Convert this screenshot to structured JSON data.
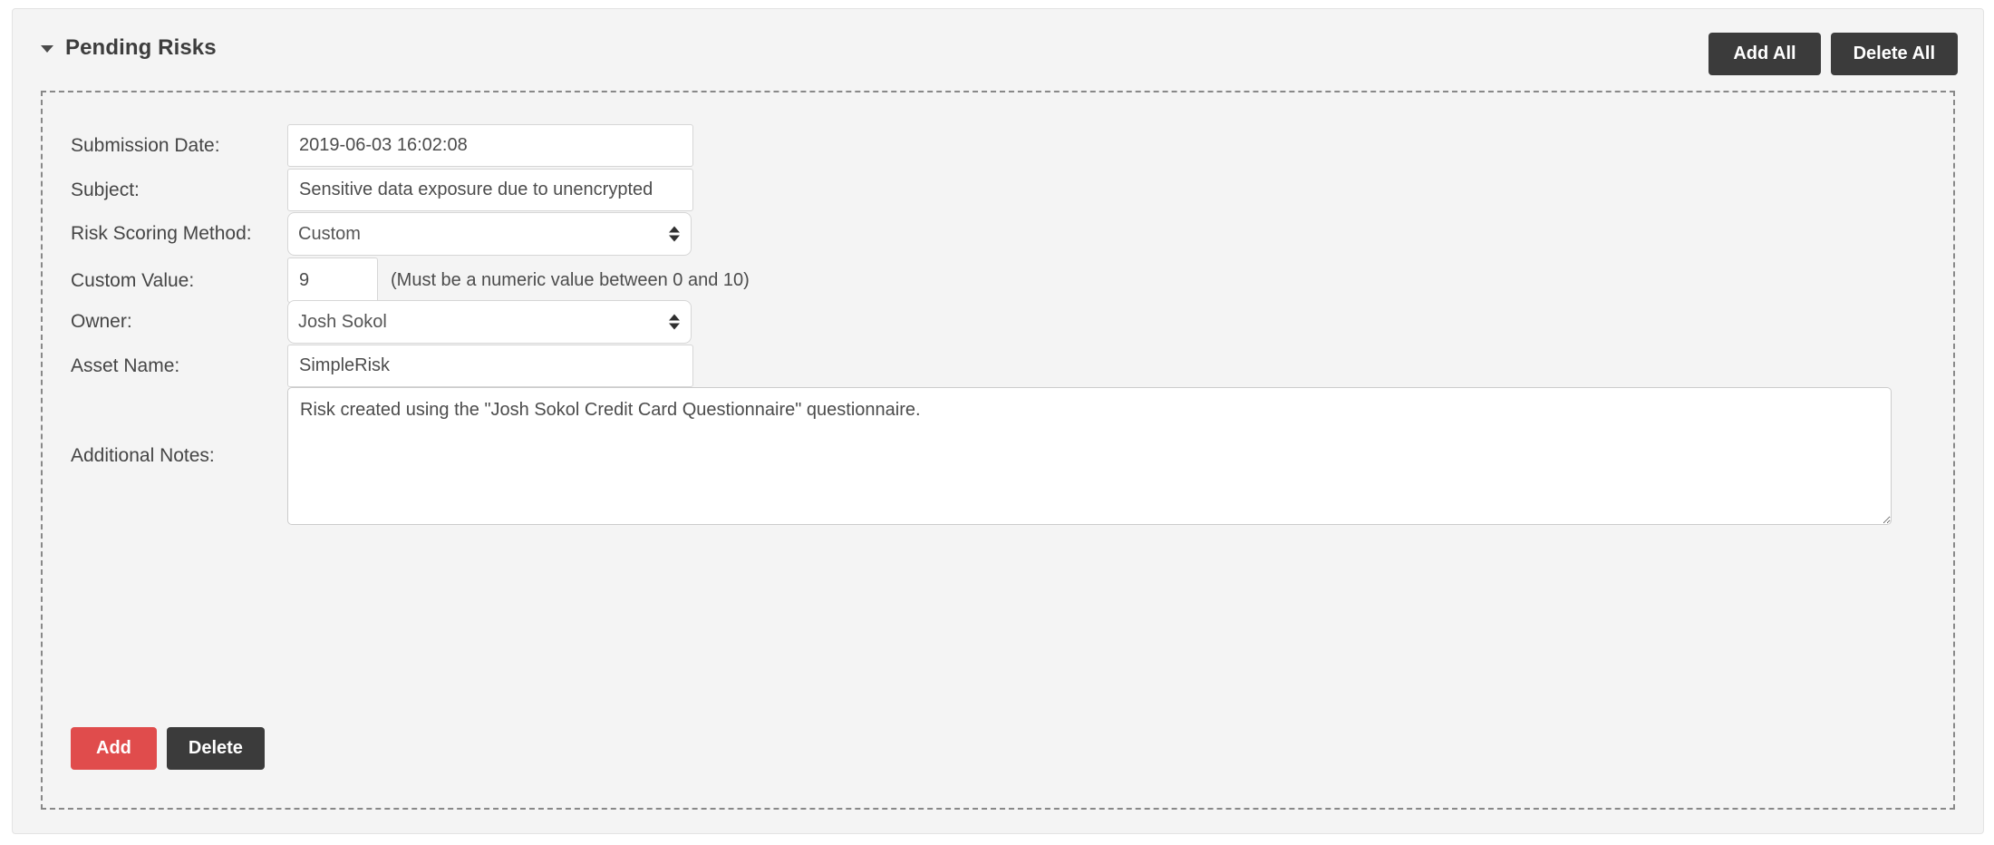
{
  "panel": {
    "title": "Pending Risks",
    "caret_icon": "caret-down-icon",
    "add_all_label": "Add All",
    "delete_all_label": "Delete All",
    "colors": {
      "panel_bg": "#f4f4f4",
      "dark_button": "#3b3b3b",
      "red_button": "#e04c4c",
      "dashed_border": "#888888"
    }
  },
  "form": {
    "submission_date": {
      "label": "Submission Date:",
      "value": "2019-06-03 16:02:08",
      "placeholder": ""
    },
    "subject": {
      "label": "Subject:",
      "value": "Sensitive data exposure due to unencrypted",
      "placeholder": ""
    },
    "risk_scoring_method": {
      "label": "Risk Scoring Method:",
      "value": "Custom",
      "options": [
        "Custom"
      ]
    },
    "custom_value": {
      "label": "Custom Value:",
      "value": "9",
      "hint": "(Must be a numeric value between 0 and 10)",
      "placeholder": ""
    },
    "owner": {
      "label": "Owner:",
      "value": "Josh Sokol",
      "options": [
        "Josh Sokol"
      ]
    },
    "asset_name": {
      "label": "Asset Name:",
      "value": "SimpleRisk",
      "placeholder": ""
    },
    "additional_notes": {
      "label": "Additional Notes:",
      "value": "Risk created using the \"Josh Sokol Credit Card Questionnaire\" questionnaire.",
      "placeholder": ""
    }
  },
  "actions": {
    "add_label": "Add",
    "delete_label": "Delete"
  }
}
